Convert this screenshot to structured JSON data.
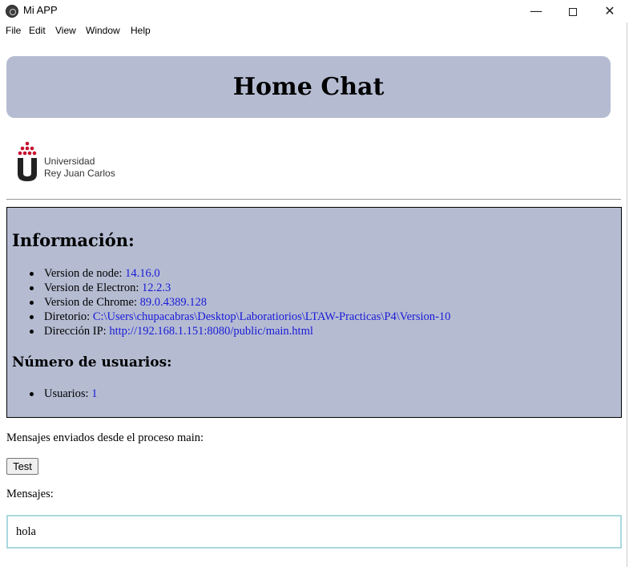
{
  "window": {
    "title": "Mi APP",
    "minimize": "—",
    "close": "✕"
  },
  "menu": [
    "File",
    "Edit",
    "View",
    "Window",
    "Help"
  ],
  "header": {
    "title": "Home Chat"
  },
  "logo": {
    "line1": "Universidad",
    "line2": "Rey Juan Carlos",
    "color": "#c8102e"
  },
  "info": {
    "heading": "Información:",
    "items": [
      {
        "label": "Version de node: ",
        "value": "14.16.0"
      },
      {
        "label": "Version de Electron: ",
        "value": "12.2.3"
      },
      {
        "label": "Version de Chrome: ",
        "value": "89.0.4389.128"
      },
      {
        "label": "Diretorio: ",
        "value": "C:\\Users\\chupacabras\\Desktop\\Laboratiorios\\LTAW-Practicas\\P4\\Version-10"
      },
      {
        "label": "Dirección IP: ",
        "value": "http://192.168.1.151:8080/public/main.html"
      }
    ],
    "users_heading": "Número de usuarios:",
    "users": {
      "label": "Usuarios: ",
      "value": "1"
    }
  },
  "main": {
    "sent_label": "Mensajes enviados desde el proceso main:",
    "test_button": "Test",
    "messages_label": "Mensajes:",
    "messages": [
      "hola"
    ]
  },
  "colors": {
    "panel": "#b5bcd2",
    "value": "#1a1ad6",
    "input_border": "#aad8de"
  }
}
